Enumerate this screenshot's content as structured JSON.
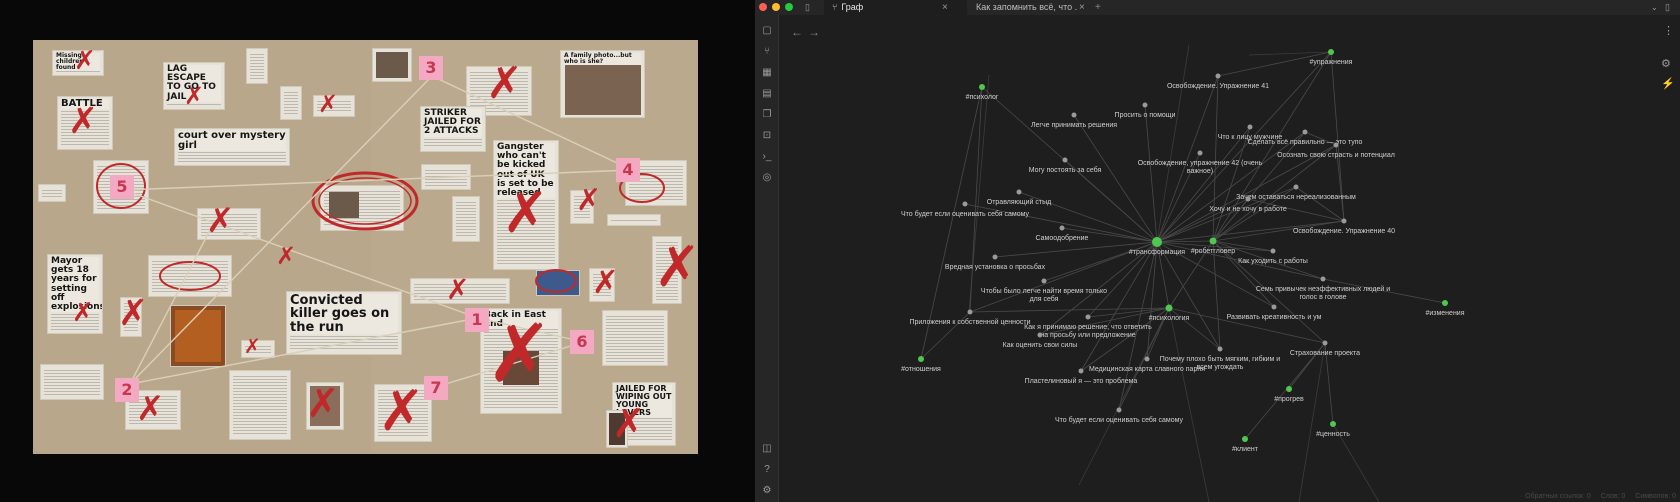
{
  "photo": {
    "headlines": [
      "LAG ESCAPE TO GO TO JAIL",
      "BATTLE",
      "court over mystery girl",
      "STRIKER JAILED FOR 2 ATTACKS",
      "Gangster who can't be kicked out of UK is set to be released",
      "A family photo...but who is she?",
      "Mayor gets 18 years for setting off explosions",
      "Convicted killer goes on the run",
      "Back in East End",
      "JAILED FOR WIPING OUT YOUNG LOVERS",
      "Missing children found"
    ],
    "notes": [
      "3",
      "4",
      "5",
      "1",
      "6",
      "2",
      "7"
    ]
  },
  "app": {
    "tabs": [
      {
        "label": "Граф",
        "icon": "graph-icon"
      },
      {
        "label": "Как запомнить всё, что ..."
      }
    ],
    "tab_close": "×",
    "new_tab": "+",
    "traffic_colors": {
      "close": "#ff5f57",
      "minimize": "#febc2e",
      "maximize": "#28c840"
    },
    "accent": "#4ec84e",
    "graph": {
      "nodes": [
        {
          "id": "n1",
          "label": "#упражнения",
          "tag": true
        },
        {
          "id": "n2",
          "label": "Освобождение. Упражнение 41",
          "tag": false
        },
        {
          "id": "n3",
          "label": "#психолог",
          "tag": true
        },
        {
          "id": "n4",
          "label": "Просить о помощи",
          "tag": false
        },
        {
          "id": "n5",
          "label": "Легче принимать решения",
          "tag": false
        },
        {
          "id": "n6",
          "label": "Что к лицу мужчине",
          "tag": false
        },
        {
          "id": "n7",
          "label": "Сделать всё правильно — это тупо",
          "tag": false
        },
        {
          "id": "n8",
          "label": "Осознать свою страсть и потенциал",
          "tag": false
        },
        {
          "id": "n9",
          "label": "Освобождение, упражнение 42 (очень важное)",
          "tag": false
        },
        {
          "id": "n10",
          "label": "Могу постоять за себя",
          "tag": false
        },
        {
          "id": "n11",
          "label": "Отравляющий стыд",
          "tag": false
        },
        {
          "id": "n12",
          "label": "Зачем оставаться нереализованным",
          "tag": false
        },
        {
          "id": "n13",
          "label": "Хочу и не хочу в работе",
          "tag": false
        },
        {
          "id": "n14",
          "label": "Что будет если оценивать себя самому",
          "tag": false
        },
        {
          "id": "n15",
          "label": "Самоодобрение",
          "tag": false
        },
        {
          "id": "n16",
          "label": "Освобождение. Упражнение 40",
          "tag": false
        },
        {
          "id": "n17",
          "label": "#трансформация",
          "tag": true
        },
        {
          "id": "n18",
          "label": "#робетгловер",
          "tag": true
        },
        {
          "id": "n19",
          "label": "Как уходить с работы",
          "tag": false
        },
        {
          "id": "n20",
          "label": "Вредная установка о просьбах",
          "tag": false
        },
        {
          "id": "n21",
          "label": "Семь привычек неэффективных людей и голос в голове",
          "tag": false
        },
        {
          "id": "n22",
          "label": "Чтобы было легче найти время только для себя",
          "tag": false
        },
        {
          "id": "n23",
          "label": "#изменения",
          "tag": true
        },
        {
          "id": "n24",
          "label": "#психология",
          "tag": true
        },
        {
          "id": "n25",
          "label": "Развивать креативность и ум",
          "tag": false
        },
        {
          "id": "n26",
          "label": "Приложения к собственной ценности",
          "tag": false
        },
        {
          "id": "n27",
          "label": "Как я принимаю решение, что ответить на просьбу или предложение",
          "tag": false
        },
        {
          "id": "n28",
          "label": "Как оценить свои силы",
          "tag": false
        },
        {
          "id": "n29",
          "label": "Страхование проекта",
          "tag": false
        },
        {
          "id": "n30",
          "label": "Почему плохо быть мягким, гибким и всем угождать",
          "tag": false
        },
        {
          "id": "n31",
          "label": "Медицинская карта славного парня",
          "tag": false
        },
        {
          "id": "n32",
          "label": "#отношения",
          "tag": true
        },
        {
          "id": "n33",
          "label": "Пластелиновый я — это проблема",
          "tag": false
        },
        {
          "id": "n34",
          "label": "#прогрев",
          "tag": true
        },
        {
          "id": "n35",
          "label": "Что будет если оценивать себя самому",
          "tag": false
        },
        {
          "id": "n36",
          "label": "#ценность",
          "tag": true
        },
        {
          "id": "n37",
          "label": "#клиент",
          "tag": true
        }
      ]
    },
    "status": [
      "Обратных ссылок: 0",
      "Слов: 0",
      "Символов: 0"
    ]
  }
}
